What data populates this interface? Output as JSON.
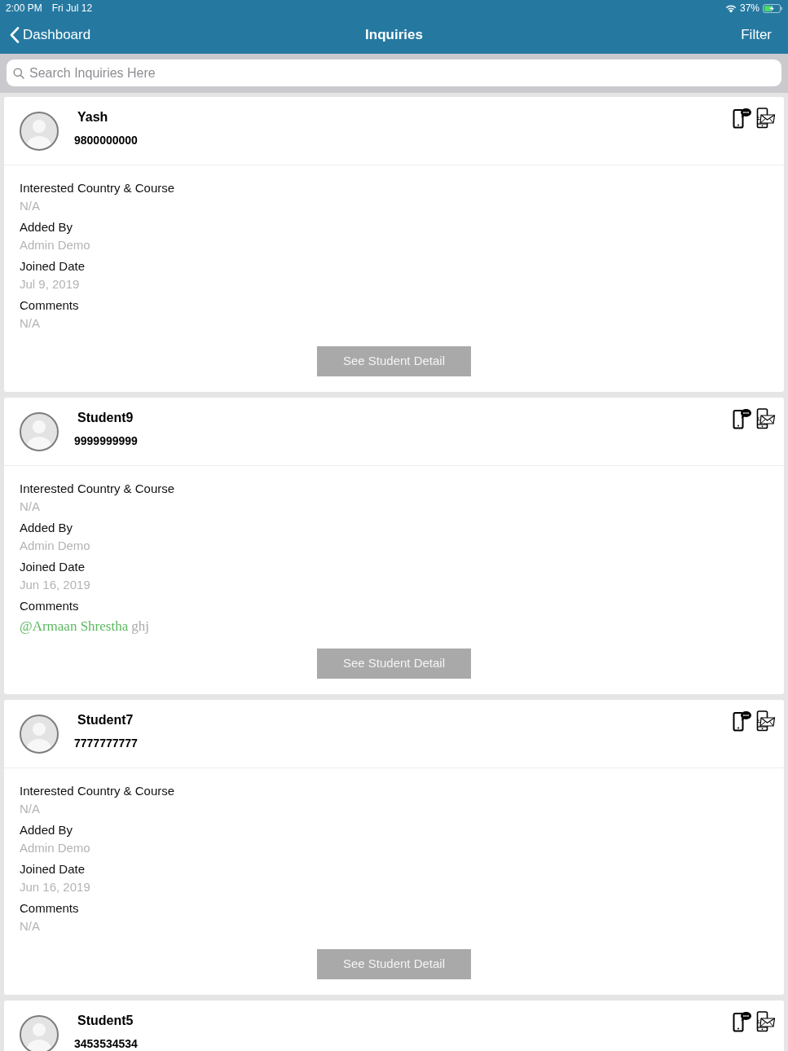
{
  "status_bar": {
    "time": "2:00 PM",
    "date": "Fri Jul 12",
    "battery": "37%"
  },
  "nav_bar": {
    "back": "Dashboard",
    "title": "Inquiries",
    "action": "Filter"
  },
  "search": {
    "placeholder": "Search Inquiries Here"
  },
  "inquiries": [
    {
      "name": "Yash",
      "phone": "9800000000",
      "fields": [
        {
          "kind": "text",
          "label": "Interested Country & Course",
          "value": "N/A"
        },
        {
          "kind": "text",
          "label": "Added By",
          "value": "Admin Demo"
        },
        {
          "kind": "text",
          "label": "Joined Date",
          "value": "Jul 9, 2019"
        },
        {
          "kind": "text",
          "label": "Comments",
          "value": "N/A"
        }
      ],
      "button": "See Student Detail"
    },
    {
      "name": "Student9",
      "phone": "9999999999",
      "fields": [
        {
          "kind": "text",
          "label": "Interested Country & Course",
          "value": "N/A"
        },
        {
          "kind": "text",
          "label": "Added By",
          "value": "Admin Demo"
        },
        {
          "kind": "text",
          "label": "Joined Date",
          "value": "Jun 16, 2019"
        },
        {
          "kind": "mention",
          "label": "Comments",
          "mention": "@Armaan Shrestha",
          "value": "ghj"
        }
      ],
      "button": "See Student Detail"
    },
    {
      "name": "Student7",
      "phone": "7777777777",
      "fields": [
        {
          "kind": "text",
          "label": "Interested Country & Course",
          "value": "N/A"
        },
        {
          "kind": "text",
          "label": "Added By",
          "value": "Admin Demo"
        },
        {
          "kind": "text",
          "label": "Joined Date",
          "value": "Jun 16, 2019"
        },
        {
          "kind": "text",
          "label": "Comments",
          "value": "N/A"
        }
      ],
      "button": "See Student Detail"
    },
    {
      "name": "Student5",
      "phone": "3453534534"
    }
  ]
}
